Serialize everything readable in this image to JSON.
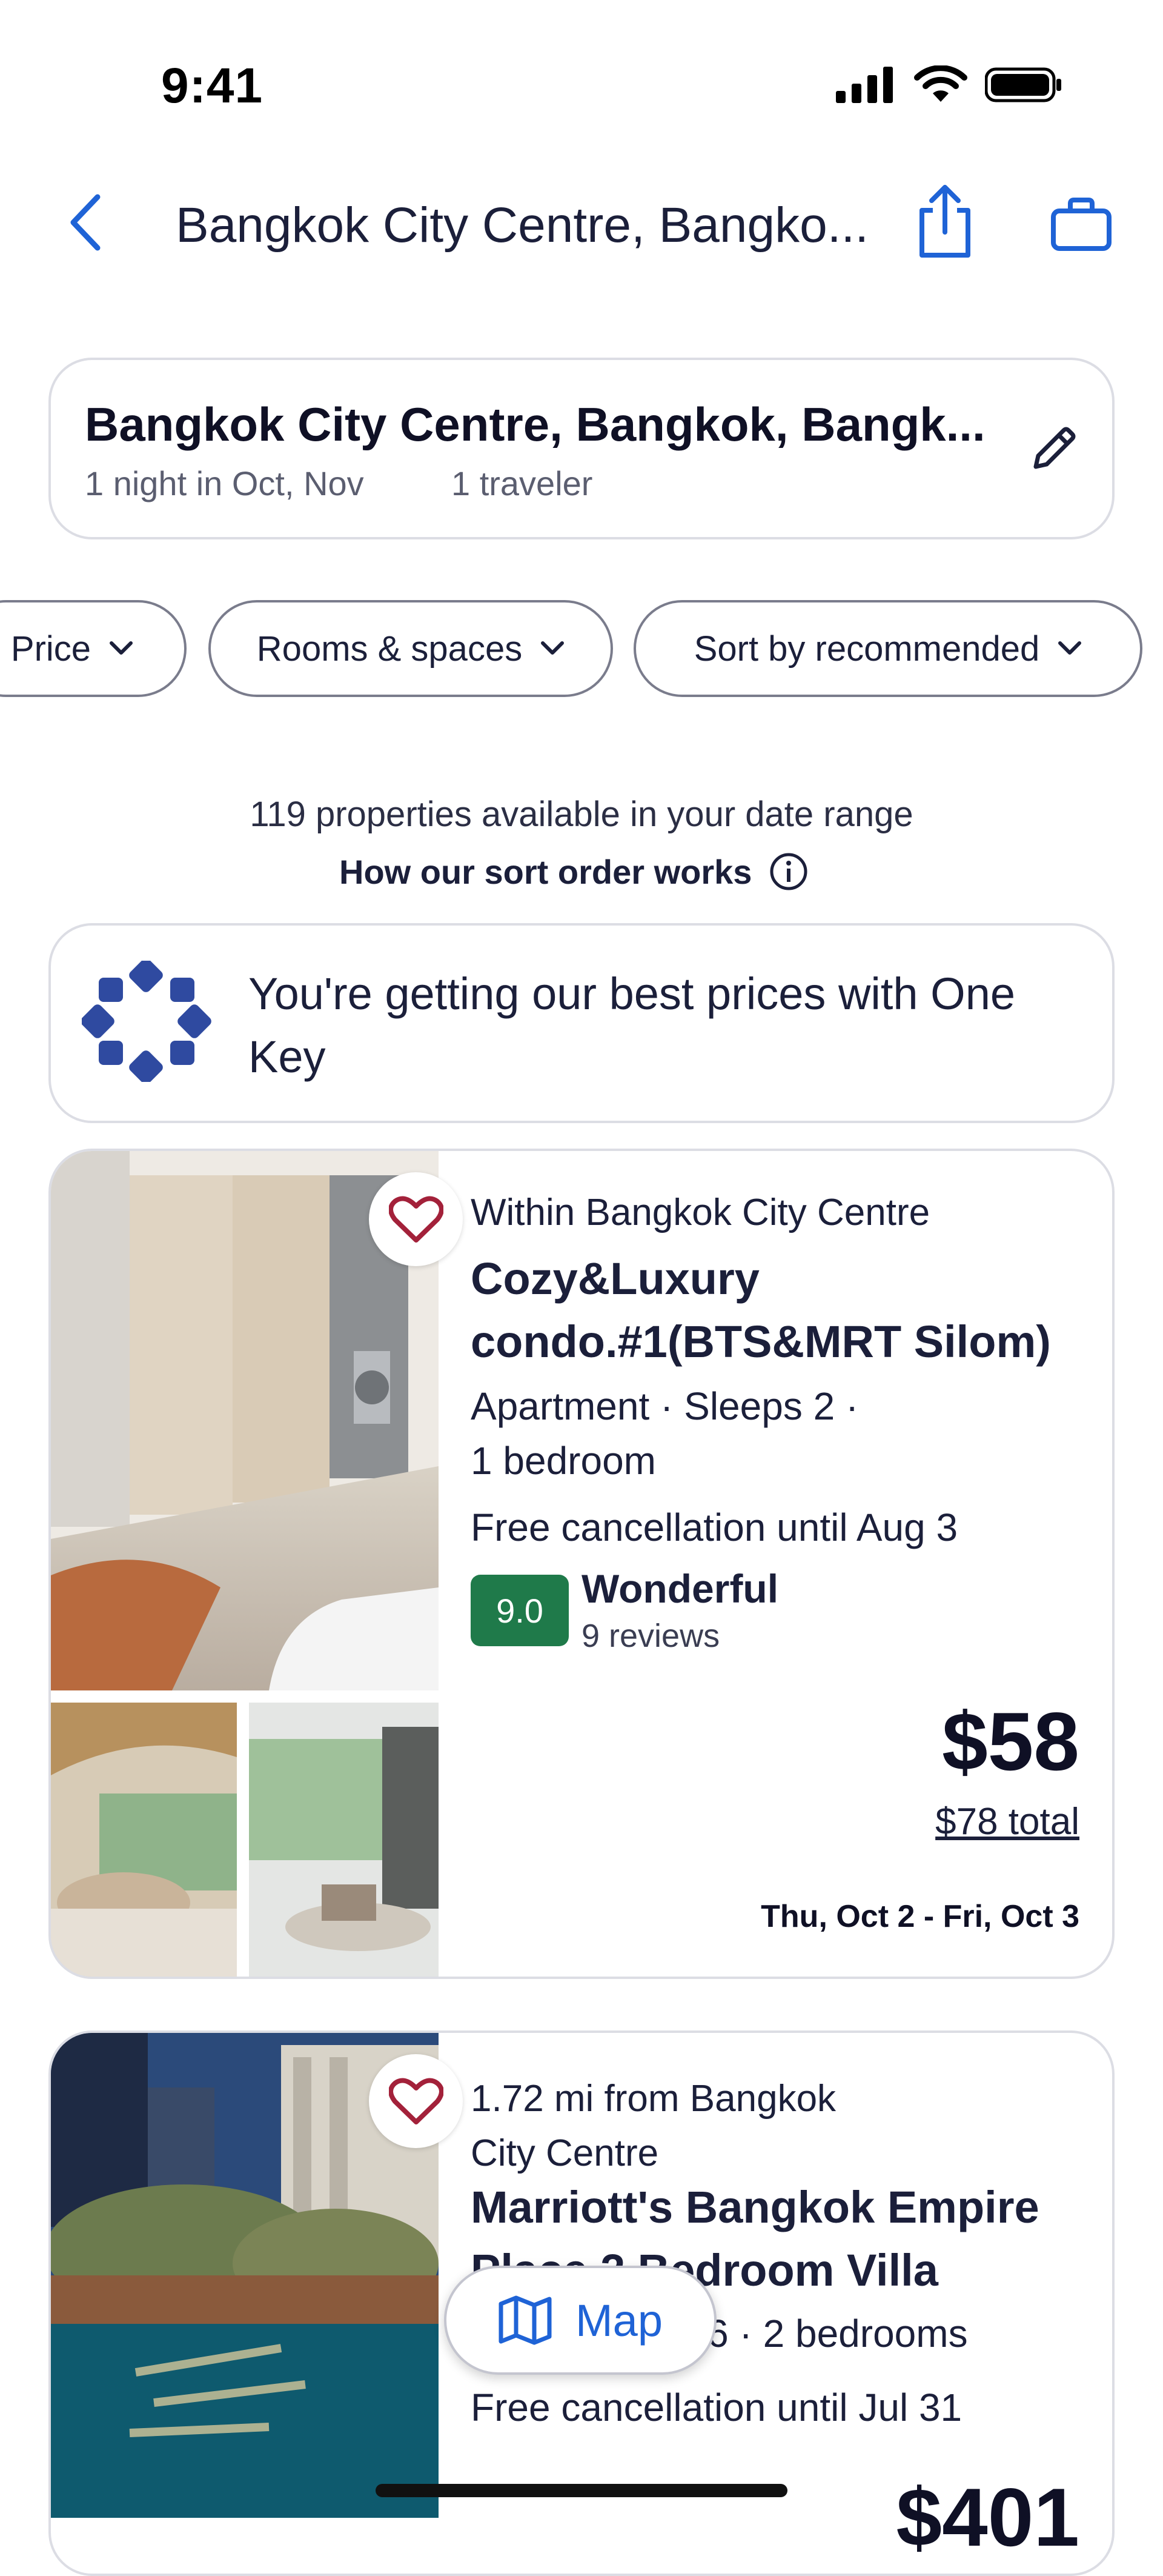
{
  "status_bar": {
    "time": "9:41"
  },
  "nav": {
    "title": "Bangkok City Centre, Bangko...",
    "back_icon": "chevron-left-icon",
    "share_icon": "share-icon",
    "trips_icon": "briefcase-icon"
  },
  "search": {
    "destination": "Bangkok City Centre, Bangkok, Bangk...",
    "dates": "1 night in Oct, Nov",
    "travelers": "1 traveler"
  },
  "filters": [
    {
      "label": "Price"
    },
    {
      "label": "Rooms & spaces"
    },
    {
      "label": "Sort by recommended"
    }
  ],
  "results": {
    "count_text": "119 properties available in your date range",
    "sort_info_label": "How our sort order works"
  },
  "onekey_banner": {
    "text": "You're getting our best prices with One Key"
  },
  "properties": [
    {
      "location": "Within Bangkok City Centre",
      "name_line1": "Cozy&Luxury",
      "name_line2": "condo.#1(BTS&MRT Silom)",
      "desc_line1": "Apartment · Sleeps 2 ·",
      "desc_line2": "1 bedroom",
      "cancellation": "Free cancellation until Aug 3",
      "score": "9.0",
      "rating_word": "Wonderful",
      "reviews": "9 reviews",
      "price": "$58",
      "total": "$78 total",
      "dates": "Thu, Oct 2 - Fri, Oct 3"
    },
    {
      "location_line1": "1.72 mi from Bangkok",
      "location_line2": "City Centre",
      "name_line1": "Marriott's Bangkok Empire",
      "name_line2": "Place 2 Bedroom Villa",
      "desc_line1": "Villa · Sleeps 6 · 2 bedrooms",
      "cancellation": "Free cancellation until Jul 31",
      "price": "$401"
    }
  ],
  "map_button": {
    "label": "Map"
  },
  "colors": {
    "accent": "#1f63d6",
    "heart": "#a3213a",
    "score_bg": "#1f7a4a",
    "onekey": "#2f4aa0"
  }
}
